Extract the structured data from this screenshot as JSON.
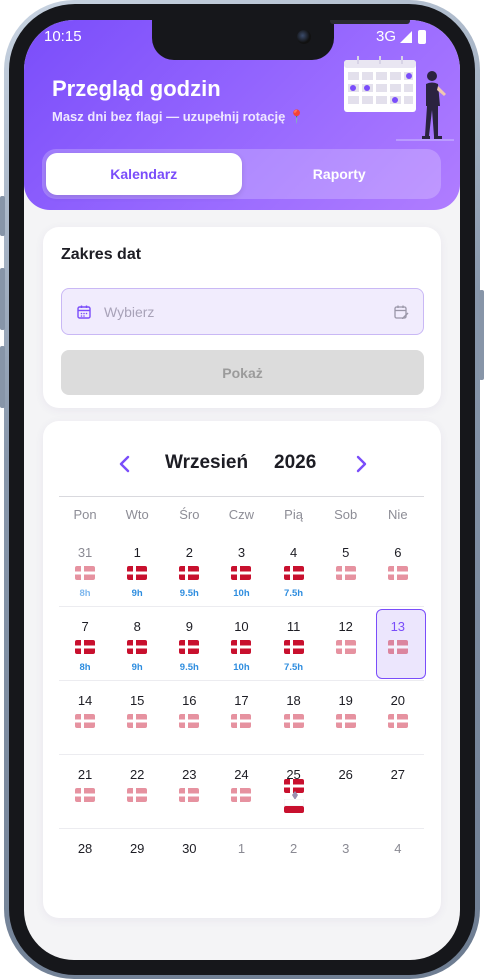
{
  "status_bar": {
    "time": "10:15",
    "network": "3G"
  },
  "header": {
    "title": "Przegląd godzin",
    "subtitle": "Masz dni bez flagi — uzupełnij rotację 📍"
  },
  "tabs": [
    {
      "label": "Kalendarz",
      "active": true
    },
    {
      "label": "Raporty",
      "active": false
    }
  ],
  "date_range": {
    "title": "Zakres dat",
    "placeholder": "Wybierz",
    "button_label": "Pokaż"
  },
  "calendar": {
    "month": "Wrzesień",
    "year": "2026",
    "weekdays": [
      "Pon",
      "Wto",
      "Śro",
      "Czw",
      "Pią",
      "Sob",
      "Nie"
    ],
    "weeks": [
      [
        {
          "day": "31",
          "muted": true,
          "flag": "faded",
          "hours": "8h",
          "hours_faded": true
        },
        {
          "day": "1",
          "flag": "solid",
          "hours": "9h"
        },
        {
          "day": "2",
          "flag": "solid",
          "hours": "9.5h"
        },
        {
          "day": "3",
          "flag": "solid",
          "hours": "10h"
        },
        {
          "day": "4",
          "flag": "solid",
          "hours": "7.5h"
        },
        {
          "day": "5",
          "flag": "faded"
        },
        {
          "day": "6",
          "flag": "faded"
        }
      ],
      [
        {
          "day": "7",
          "flag": "solid",
          "hours": "8h"
        },
        {
          "day": "8",
          "flag": "solid",
          "hours": "9h"
        },
        {
          "day": "9",
          "flag": "solid",
          "hours": "9.5h"
        },
        {
          "day": "10",
          "flag": "solid",
          "hours": "10h"
        },
        {
          "day": "11",
          "flag": "solid",
          "hours": "7.5h"
        },
        {
          "day": "12",
          "flag": "faded"
        },
        {
          "day": "13",
          "flag": "faded",
          "selected": true
        }
      ],
      [
        {
          "day": "14",
          "flag": "faded"
        },
        {
          "day": "15",
          "flag": "faded"
        },
        {
          "day": "16",
          "flag": "faded"
        },
        {
          "day": "17",
          "flag": "faded"
        },
        {
          "day": "18",
          "flag": "faded"
        },
        {
          "day": "19",
          "flag": "faded"
        },
        {
          "day": "20",
          "flag": "faded"
        }
      ],
      [
        {
          "day": "21",
          "flag": "faded"
        },
        {
          "day": "22",
          "flag": "faded"
        },
        {
          "day": "23",
          "flag": "faded"
        },
        {
          "day": "24",
          "flag": "faded"
        },
        {
          "day": "25",
          "flag": "stacked"
        },
        {
          "day": "26"
        },
        {
          "day": "27"
        }
      ],
      [
        {
          "day": "28"
        },
        {
          "day": "29"
        },
        {
          "day": "30"
        },
        {
          "day": "1",
          "muted": true
        },
        {
          "day": "2",
          "muted": true
        },
        {
          "day": "3",
          "muted": true
        },
        {
          "day": "4",
          "muted": true
        }
      ]
    ]
  },
  "colors": {
    "accent": "#7a4dfa",
    "hours_text": "#2e8ddf",
    "flag_red": "#c8102e",
    "flag_white": "#ffffff"
  }
}
